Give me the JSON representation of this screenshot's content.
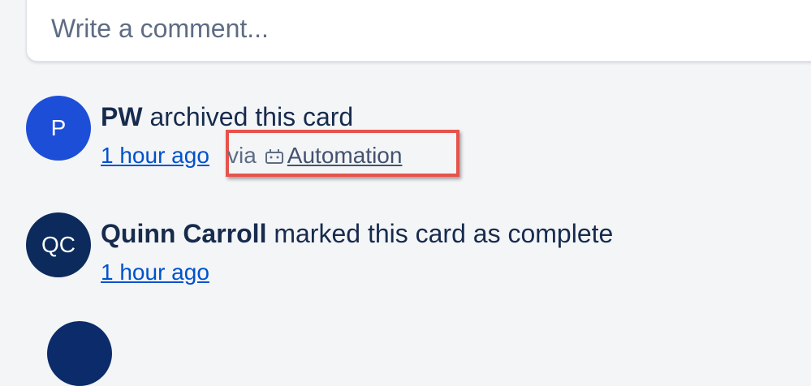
{
  "comment": {
    "placeholder": "Write a comment..."
  },
  "activities": [
    {
      "avatar_initials": "P",
      "avatar_color": "#1d4ed8",
      "actor": "PW",
      "action": "archived this card",
      "time": "1 hour ago",
      "via_label": "via",
      "via_icon": "robot-icon",
      "via_link": "Automation"
    },
    {
      "avatar_initials": "QC",
      "avatar_color": "#0c2b5c",
      "actor": "Quinn Carroll",
      "action": "marked this card as complete",
      "time": "1 hour ago"
    }
  ],
  "highlight_color": "#e5534b"
}
